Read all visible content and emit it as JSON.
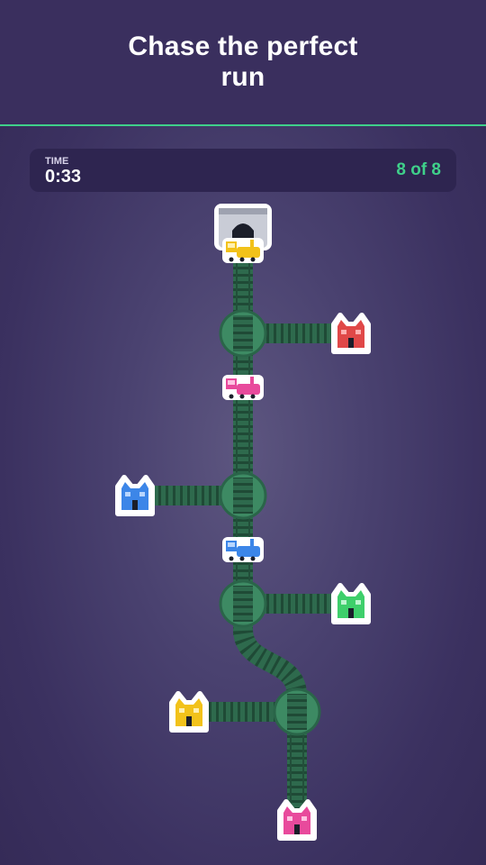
{
  "header": {
    "title": "Chase the perfect run"
  },
  "hud": {
    "time_label": "TIME",
    "time_value": "0:33",
    "progress": "8 of 8"
  },
  "colors": {
    "accent": "#3fd08a",
    "track": "#2e6a4d",
    "switch": "#3d8a63",
    "tunnel": "#c9ccd6",
    "red": "#e04848",
    "blue": "#3c86e8",
    "green": "#3ecf6b",
    "yellow": "#f2c21a",
    "pink": "#e84a9c"
  },
  "stations": [
    {
      "name": "red-station",
      "color": "red"
    },
    {
      "name": "blue-station",
      "color": "blue"
    },
    {
      "name": "green-station",
      "color": "green"
    },
    {
      "name": "yellow-station",
      "color": "yellow"
    },
    {
      "name": "pink-station",
      "color": "pink"
    }
  ],
  "trains": [
    {
      "name": "yellow-train",
      "color": "yellow"
    },
    {
      "name": "pink-train",
      "color": "pink"
    },
    {
      "name": "blue-train",
      "color": "blue"
    }
  ],
  "switches": 4
}
